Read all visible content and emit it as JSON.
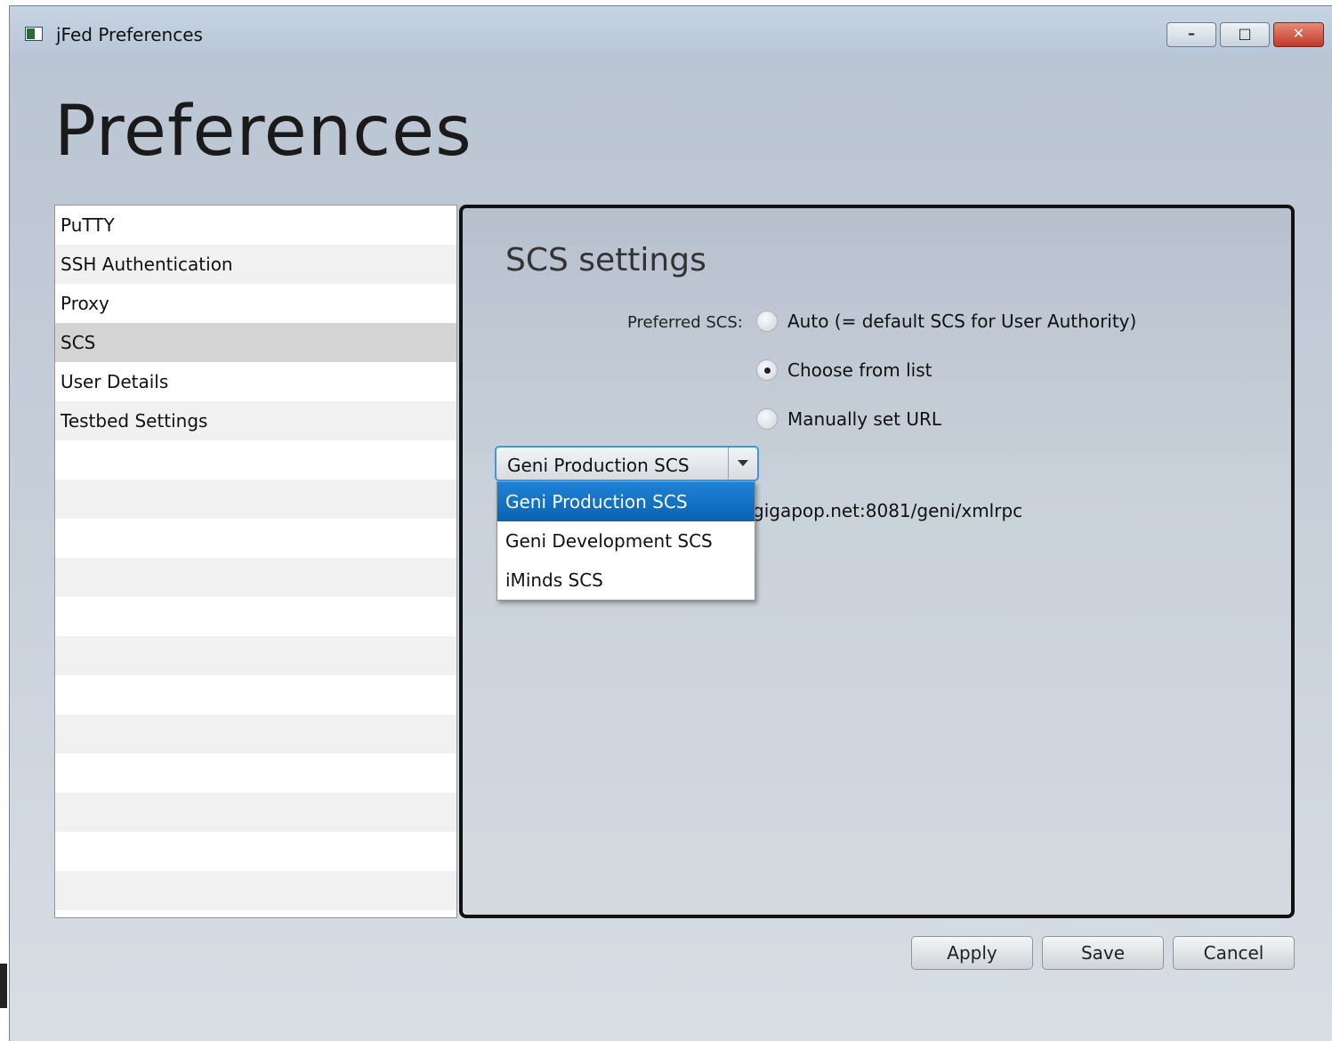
{
  "window": {
    "title": "jFed Preferences",
    "controls": {
      "minimize": "–",
      "maximize": "□",
      "close": "✕"
    }
  },
  "page": {
    "heading": "Preferences"
  },
  "sidebar": {
    "items": [
      {
        "label": "PuTTY",
        "selected": false
      },
      {
        "label": "SSH Authentication",
        "selected": false
      },
      {
        "label": "Proxy",
        "selected": false
      },
      {
        "label": "SCS",
        "selected": true
      },
      {
        "label": "User Details",
        "selected": false
      },
      {
        "label": "Testbed Settings",
        "selected": false
      }
    ]
  },
  "scs": {
    "title": "SCS settings",
    "preferred_label": "Preferred SCS:",
    "options": [
      {
        "label": "Auto (= default SCS for User Authority)",
        "checked": false
      },
      {
        "label": "Choose from list",
        "checked": true
      },
      {
        "label": "Manually set URL",
        "checked": false
      }
    ],
    "combo": {
      "value": "Geni Production SCS",
      "items": [
        "Geni Production SCS",
        "Geni Development SCS",
        "iMinds SCS"
      ],
      "highlighted": "Geni Production SCS"
    },
    "url_fragment": "gigapop.net:8081/geni/xmlrpc"
  },
  "buttons": {
    "apply": "Apply",
    "save": "Save",
    "cancel": "Cancel"
  },
  "colors": {
    "selection": "#0a62b2",
    "focus": "#3e97df",
    "panel_border": "#111111"
  }
}
